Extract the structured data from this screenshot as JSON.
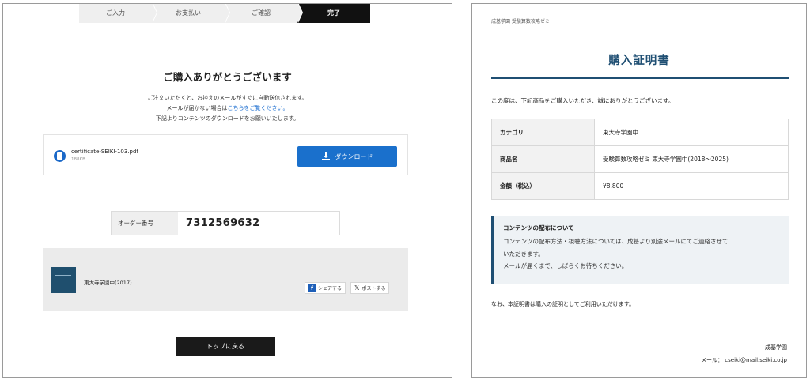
{
  "left": {
    "steps": [
      {
        "label": "ご入力",
        "active": false
      },
      {
        "label": "お支払い",
        "active": false
      },
      {
        "label": "ご確認",
        "active": false
      },
      {
        "label": "完了",
        "active": true
      }
    ],
    "title": "ご購入ありがとうございます",
    "message": {
      "line1": "ご注文いただくと、お控えのメールがすぐに自動送信されます。",
      "line2_pre": "メールが届かない場合は",
      "line2_link": "こちらをご覧ください。",
      "line3": "下記よりコンテンツのダウンロードをお願いいたします。"
    },
    "file": {
      "name": "certificate-SEIKI-103.pdf",
      "size": "188KB",
      "download_label": "ダウンロード"
    },
    "order": {
      "label": "オーダー番号",
      "value": "7312569632"
    },
    "product": {
      "name": "東大寺学園中(2017)",
      "share_facebook": "シェアする",
      "share_x": "ポストする"
    },
    "top_button": "トップに戻る"
  },
  "right": {
    "org_header": "成基学園 受験算数攻略ゼミ",
    "title": "購入証明書",
    "intro": "この度は、下記商品をご購入いただき、誠にありがとうございます。",
    "rows": [
      {
        "key": "カテゴリ",
        "value": "東大寺学園中"
      },
      {
        "key": "商品名",
        "value": "受験算数攻略ゼミ 東大寺学園中(2018〜2025)"
      },
      {
        "key": "金額（税込）",
        "value": "¥8,800"
      }
    ],
    "notice": {
      "title": "コンテンツの配布について",
      "line1": "コンテンツの配布方法・視聴方法については、成基より別途メールにてご連絡させて",
      "line2": "いただきます。",
      "line3": "メールが届くまで、しばらくお待ちください。"
    },
    "footnote": "なお、本証明書は購入の証明としてご利用いただけます。",
    "sender_name": "成基学園",
    "sender_mail": "メール： cseiki@mail.seiki.co.jp"
  },
  "colors": {
    "accent_blue": "#1a70cc",
    "cert_navy": "#1f4f73",
    "dark_button": "#1a1a1a"
  }
}
